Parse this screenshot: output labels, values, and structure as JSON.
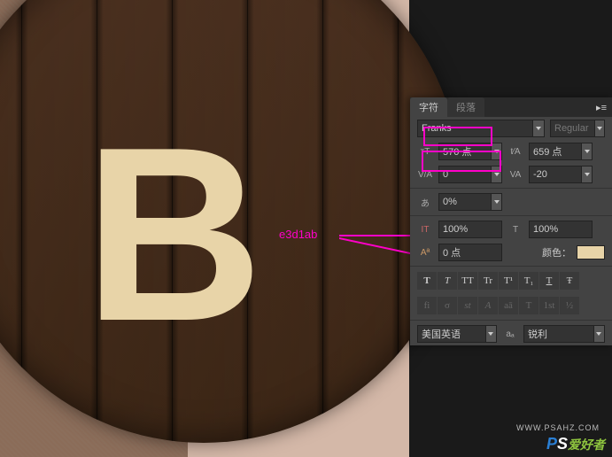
{
  "canvas": {
    "letter": "B",
    "annotation": "e3d1ab"
  },
  "panel": {
    "tabs": {
      "char": "字符",
      "para": "段落"
    },
    "font": {
      "family": "Franks",
      "style": "Regular"
    },
    "size": {
      "value": "570 点",
      "leading": "659 点"
    },
    "kerning": {
      "va": "0",
      "tracking": "-20"
    },
    "scale": {
      "pct": "0%"
    },
    "vh": {
      "vert": "100%",
      "horiz": "100%"
    },
    "baseline": {
      "shift": "0 点",
      "color_label": "颜色："
    },
    "style_row1": [
      "T",
      "T",
      "TT",
      "Tr",
      "T¹",
      "T₁",
      "T",
      "Ŧ"
    ],
    "style_row2": [
      "fi",
      "σ",
      "st",
      "A",
      "aā",
      "T",
      "1st",
      "½"
    ],
    "lang": {
      "value": "美国英语",
      "aa": "aₐ",
      "aliasing": "锐利"
    }
  },
  "watermark": {
    "url": "WWW.PSAHZ.COM",
    "brand_p": "P",
    "brand_s": "S",
    "brand_rest": "爱好者"
  }
}
